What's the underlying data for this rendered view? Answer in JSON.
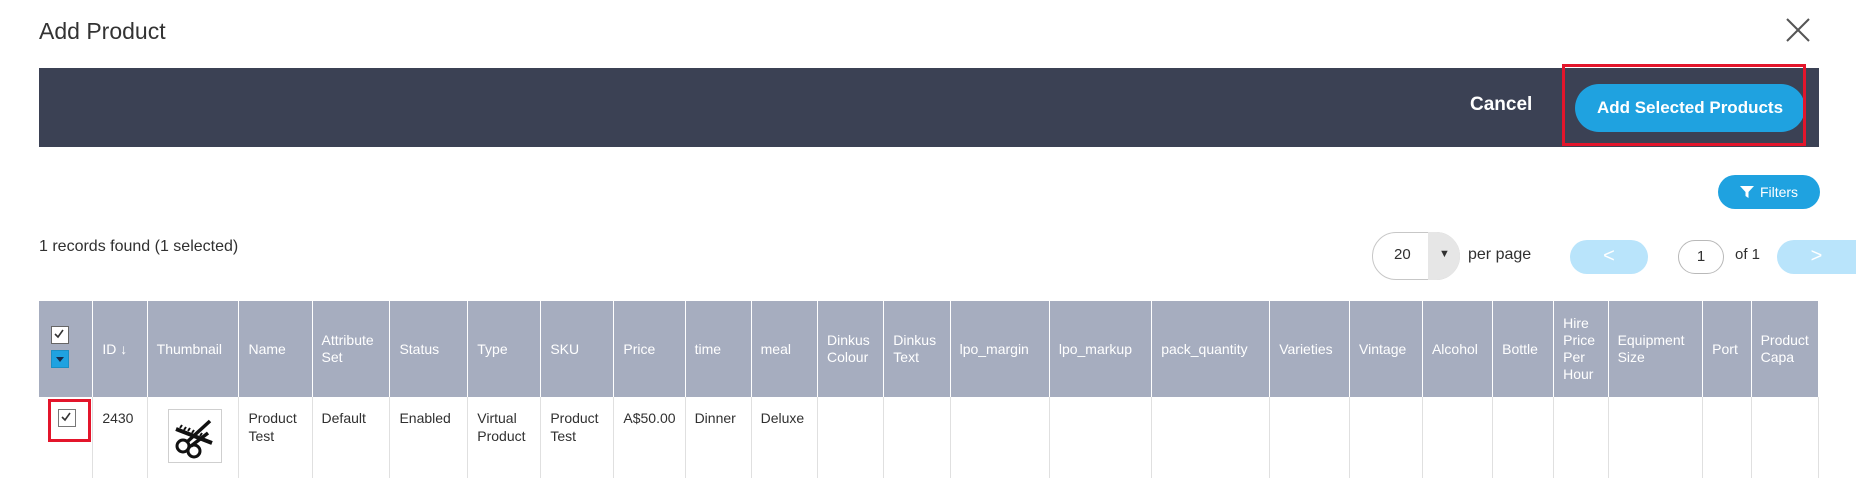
{
  "dialog": {
    "title": "Add Product"
  },
  "toolbar": {
    "cancel_label": "Cancel",
    "add_selected_label": "Add Selected Products"
  },
  "filters": {
    "label": "Filters"
  },
  "summary": {
    "records_text": "1 records found (1 selected)"
  },
  "pagination": {
    "per_page_value": "20",
    "per_page_label": "per page",
    "prev_symbol": "<",
    "current_page": "1",
    "of_label": "of 1",
    "next_symbol": ">"
  },
  "grid": {
    "sort_indicator": "↓",
    "columns": [
      "ID",
      "Thumbnail",
      "Name",
      "Attribute Set",
      "Status",
      "Type",
      "SKU",
      "Price",
      "time",
      "meal",
      "Dinkus Colour",
      "Dinkus Text",
      "lpo_margin",
      "lpo_markup",
      "pack_quantity",
      "Varieties",
      "Vintage",
      "Alcohol",
      "Bottle",
      "Hire Price Per Hour",
      "Equipment Size",
      "Port",
      "Product Capa"
    ],
    "rows": [
      {
        "checked": true,
        "id": "2430",
        "thumbnail_icon": "scissors-icon",
        "name": "Product Test",
        "attribute_set": "Default",
        "status": "Enabled",
        "type": "Virtual Product",
        "sku": "Product Test",
        "price": "A$50.00",
        "time": "Dinner",
        "meal": "Deluxe",
        "dinkus_colour": "",
        "dinkus_text": "",
        "lpo_margin": "",
        "lpo_markup": "",
        "pack_quantity": "",
        "varieties": "",
        "vintage": "",
        "alcohol": "",
        "bottle": "",
        "hire_price_per_hour": "",
        "equipment_size": "",
        "port": "",
        "product_capa": ""
      }
    ]
  },
  "colors": {
    "toolbar_bg": "#3b4154",
    "primary_blue": "#1fa2e0",
    "header_bg": "#a6adbf",
    "highlight_red": "#e3152b"
  }
}
